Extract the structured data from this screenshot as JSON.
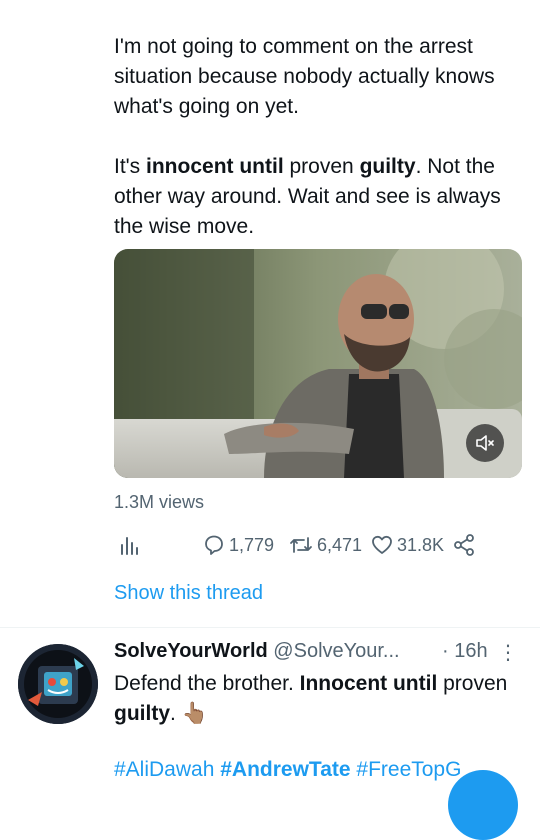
{
  "tweet": {
    "para1": "I'm not going to comment on the arrest situation because nobody actually knows what's going on yet.",
    "para2_a": "It's ",
    "para2_b": "innocent until",
    "para2_c": " proven ",
    "para2_d": "guilty",
    "para2_e": ". Not the other way around. Wait and see is always the wise move.",
    "views": "1.3M views",
    "reply_count": "1,779",
    "retweet_count": "6,471",
    "like_count": "31.8K",
    "show_thread": "Show this thread"
  },
  "reply": {
    "name": "SolveYourWorld",
    "handle": "@SolveYour...",
    "time": "· 16h",
    "more": "⋮",
    "text_a": "Defend the brother. ",
    "text_b": "Innocent until",
    "text_c": " proven ",
    "text_d": "guilty",
    "text_e": ". 👆🏽",
    "tag1": "#AliDawah",
    "tag2": "#AndrewTate",
    "tag3": "#FreeTopG"
  },
  "icons": {
    "analytics": "analytics-icon",
    "reply": "reply-icon",
    "retweet": "retweet-icon",
    "like": "heart-icon",
    "share": "share-icon",
    "mute": "muted-speaker-icon"
  },
  "colors": {
    "accent": "#1d9bf0",
    "secondary_text": "#536471"
  }
}
